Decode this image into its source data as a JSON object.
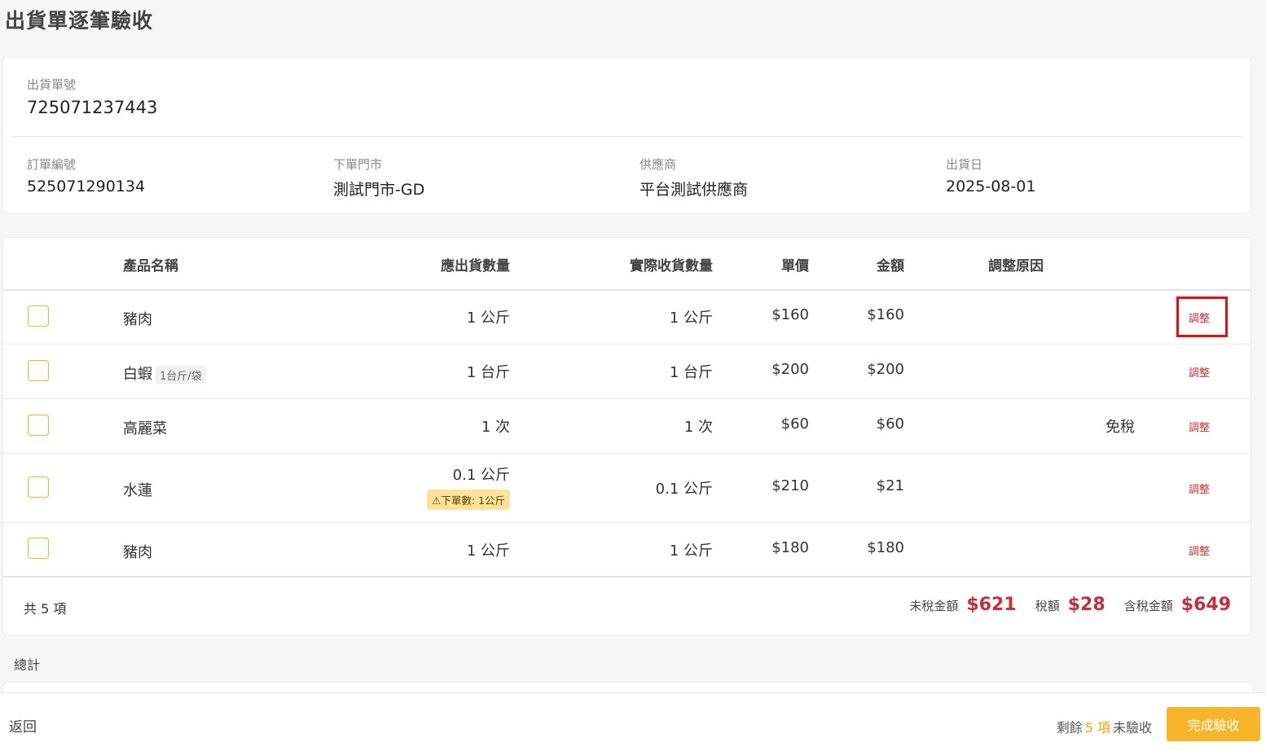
{
  "page_title": "出貨單逐筆驗收",
  "shipment": {
    "number_label": "出貨單號",
    "number": "725071237443",
    "fields": [
      {
        "label": "訂單編號",
        "value": "525071290134"
      },
      {
        "label": "下單門市",
        "value": "測試門市-GD"
      },
      {
        "label": "供應商",
        "value": "平台測試供應商"
      },
      {
        "label": "出貨日",
        "value": "2025-08-01"
      }
    ]
  },
  "table": {
    "headers": {
      "product": "產品名稱",
      "expected_qty": "應出貨數量",
      "received_qty": "實際收貨數量",
      "unit_price": "單價",
      "amount": "金額",
      "reason": "調整原因"
    },
    "rows": [
      {
        "product": "豬肉",
        "unit_tag": "",
        "expected_qty": "1 公斤",
        "warning": "",
        "received_qty": "1 公斤",
        "unit_price": "$160",
        "amount": "$160",
        "reason": "",
        "tax_note": "",
        "action": "調整"
      },
      {
        "product": "白蝦",
        "unit_tag": "1台斤/袋",
        "expected_qty": "1 台斤",
        "warning": "",
        "received_qty": "1 台斤",
        "unit_price": "$200",
        "amount": "$200",
        "reason": "",
        "tax_note": "",
        "action": "調整"
      },
      {
        "product": "高麗菜",
        "unit_tag": "",
        "expected_qty": "1 次",
        "warning": "",
        "received_qty": "1 次",
        "unit_price": "$60",
        "amount": "$60",
        "reason": "",
        "tax_note": "免稅",
        "action": "調整"
      },
      {
        "product": "水蓮",
        "unit_tag": "",
        "expected_qty": "0.1 公斤",
        "warning": "⚠下單數: 1公斤",
        "received_qty": "0.1 公斤",
        "unit_price": "$210",
        "amount": "$21",
        "reason": "",
        "tax_note": "",
        "action": "調整"
      },
      {
        "product": "豬肉",
        "unit_tag": "",
        "expected_qty": "1 公斤",
        "warning": "",
        "received_qty": "1 公斤",
        "unit_price": "$180",
        "amount": "$180",
        "reason": "",
        "tax_note": "",
        "action": "調整"
      }
    ],
    "footer": {
      "count_text": "共 5 項",
      "pretax_label": "未稅金額",
      "pretax_value": "$621",
      "tax_label": "稅額",
      "tax_value": "$28",
      "total_label": "含稅金額",
      "total_value": "$649"
    }
  },
  "summary_label": "總計",
  "bottom_bar": {
    "back_label": "返回",
    "remaining_prefix": "剩餘",
    "remaining_count": "5 項",
    "remaining_suffix": "未驗收",
    "complete_label": "完成驗收"
  },
  "colors": {
    "accent": "#f7b529",
    "danger": "#c62f3a",
    "highlight": "#e01010",
    "warning_bg": "#fde29a"
  }
}
